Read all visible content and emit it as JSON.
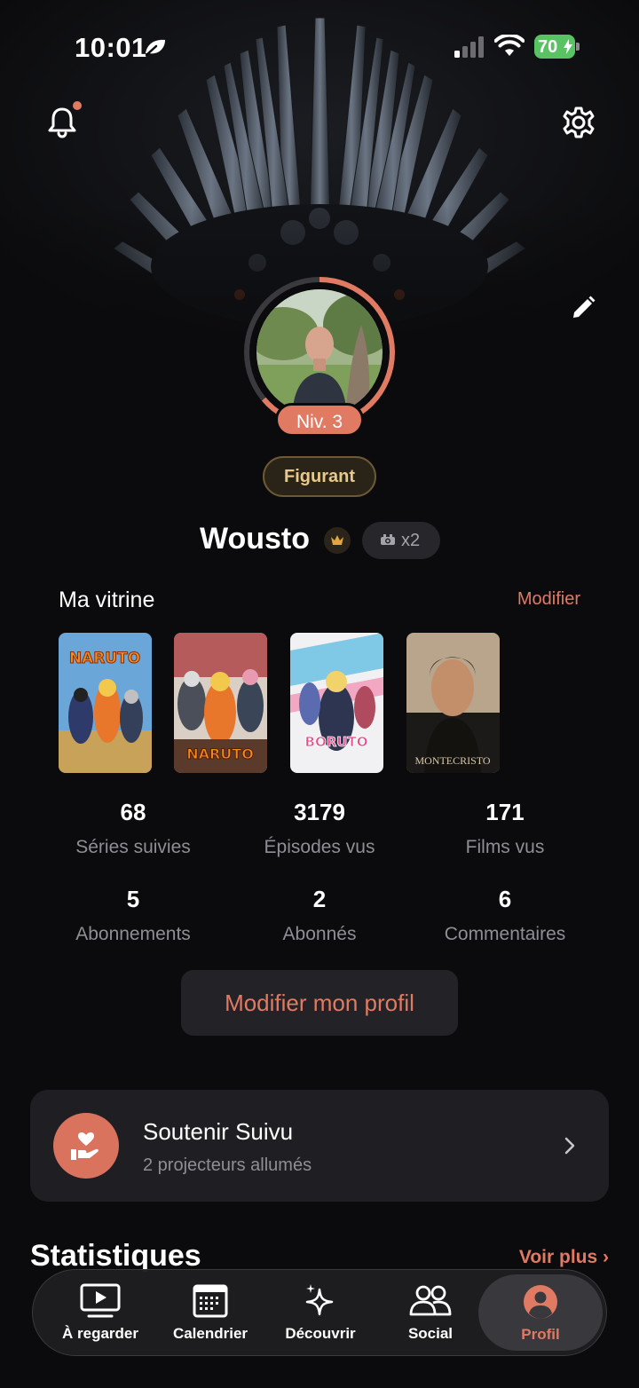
{
  "status_bar": {
    "time": "10:01",
    "battery": "70"
  },
  "header": {
    "icons": [
      "bell-icon",
      "gear-icon",
      "pencil-icon"
    ]
  },
  "profile": {
    "level": "Niv. 3",
    "level_progress": 0.64,
    "rank": "Figurant",
    "username": "Wousto",
    "multiplier": "x2"
  },
  "vitrine": {
    "title": "Ma vitrine",
    "edit_label": "Modifier",
    "posters": [
      {
        "title": "NARUTO"
      },
      {
        "title": "NARUTO"
      },
      {
        "title": "BORUTO"
      },
      {
        "title": "MONTECRISTO"
      }
    ]
  },
  "stats": [
    {
      "value": "68",
      "label": "Séries suivies"
    },
    {
      "value": "3179",
      "label": "Épisodes vus"
    },
    {
      "value": "171",
      "label": "Films vus"
    },
    {
      "value": "5",
      "label": "Abonnements"
    },
    {
      "value": "2",
      "label": "Abonnés"
    },
    {
      "value": "6",
      "label": "Commentaires"
    }
  ],
  "edit_profile_label": "Modifier mon profil",
  "support": {
    "title": "Soutenir Suivu",
    "subtitle": "2 projecteurs allumés"
  },
  "statistics_section": {
    "title": "Statistiques",
    "more_label": "Voir plus ›"
  },
  "tabs": [
    {
      "label": "À regarder",
      "icon": "play-screen-icon",
      "active": false
    },
    {
      "label": "Calendrier",
      "icon": "calendar-icon",
      "active": false
    },
    {
      "label": "Découvrir",
      "icon": "sparkles-icon",
      "active": false
    },
    {
      "label": "Social",
      "icon": "people-icon",
      "active": false
    },
    {
      "label": "Profil",
      "icon": "profile-icon",
      "active": true
    }
  ],
  "colors": {
    "accent": "#e07a63",
    "background": "#0b0b0d",
    "card": "#1f1f23"
  }
}
